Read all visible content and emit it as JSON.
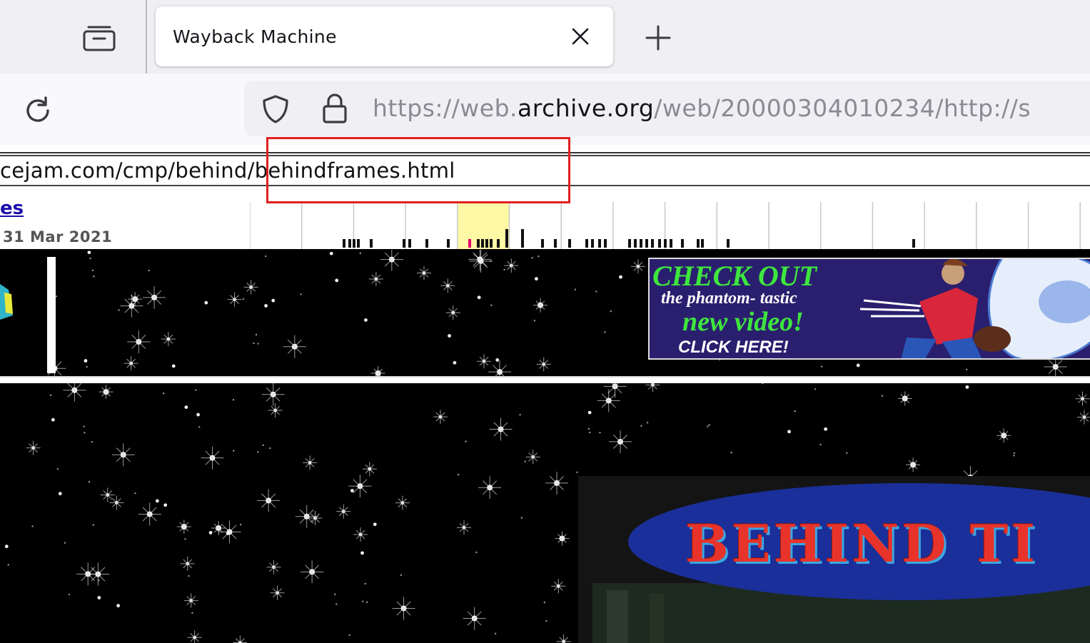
{
  "browser": {
    "tab": {
      "title": "Wayback Machine"
    },
    "address_bar": {
      "url_prefix": "https://web.",
      "url_domain": "archive.org",
      "url_suffix": "/web/20000304010234/http://s"
    },
    "colors": {
      "chrome_bg": "#f0f0f4",
      "navbar_bg": "#f9f9fb",
      "text": "#15141a",
      "url_muted": "#8a8a93"
    }
  },
  "wayback": {
    "url_field_value": "cejam.com/cmp/behind/behindframes.html",
    "captures_link": "es",
    "date_range_end": "31 Mar 2021",
    "highlight_color": "#fff9a6",
    "annotation_color": "#e02020"
  },
  "archived_page": {
    "ad": {
      "line1": "CHECK OUT",
      "line2": "the phantom- tastic",
      "line3": "new video!",
      "line4": "CLICK HERE!"
    },
    "banner_title": "BEHIND TI"
  }
}
